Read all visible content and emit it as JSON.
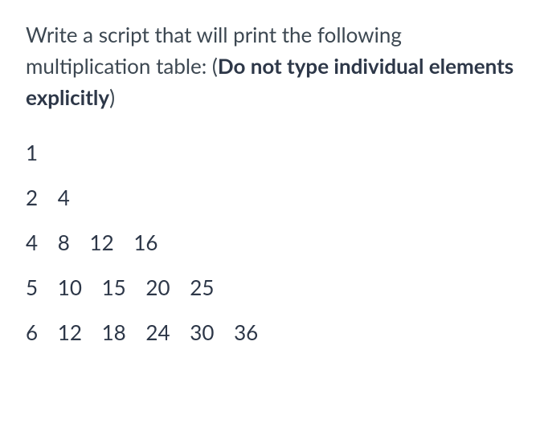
{
  "prompt": {
    "text_before": "Write a script that will print the following multiplication table: (",
    "text_bold": "Do not type individual elements explicitly",
    "text_after": ")"
  },
  "table": {
    "rows": [
      [
        1
      ],
      [
        2,
        4
      ],
      [
        4,
        8,
        12,
        16
      ],
      [
        5,
        10,
        15,
        20,
        25
      ],
      [
        6,
        12,
        18,
        24,
        30,
        36
      ]
    ]
  }
}
